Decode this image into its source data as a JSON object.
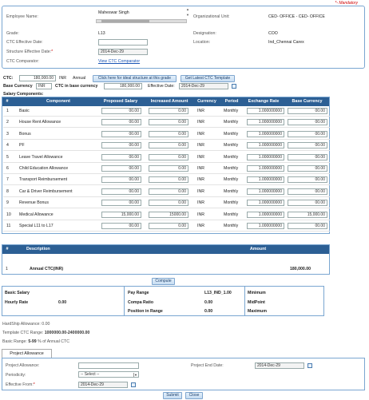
{
  "mandatory_note": "*- Mandatory",
  "employee": {
    "name_label": "Employee Name:",
    "name_value": "Maheswar Singh",
    "grade_label": "Grade:",
    "grade_value": "L13",
    "ctc_eff_label": "CTC Effective Date:",
    "ctc_eff_value": "",
    "struct_eff_label": "Structure Effective Date:",
    "struct_eff_value": "2014-Dec-29",
    "comparator_label": "CTC Comparator:",
    "comparator_link": "View CTC Comparator",
    "org_label": "Organizational Unit:",
    "org_value": "CED- OFFICE - CED- OFFICE",
    "desig_label": "Designation:",
    "desig_value": "COO",
    "location_label": "Location:",
    "location_value": "Ind_Chennai Carex"
  },
  "ctc_bar": {
    "ctc_label": "CTC:",
    "ctc_value": "180,000.00",
    "currency": "INR",
    "period": "Annual",
    "ideal_btn": "Click here for ideal structure at this grade",
    "latest_btn": "Get Latest CTC Template",
    "base_currency_label": "Base Currency",
    "base_currency_value": "INR",
    "ctc_base_label": "CTC in base currency",
    "ctc_base_value": "180,000.00",
    "eff_date_label": "Effective Date:",
    "eff_date_value": "2014-Dec-29"
  },
  "salary_components_title": "Salary Components:",
  "salary_table": {
    "headers": [
      "#",
      "Component",
      "Proposed Salary",
      "Increased Amount",
      "Currency",
      "Period",
      "Exchange Rate",
      "Base Currency"
    ],
    "rows": [
      {
        "no": "1",
        "name": "Basic",
        "proposed": "00.00",
        "increase": "0.00",
        "currency": "INR",
        "period": "Monthly",
        "rate": "1.000000000",
        "base": "00.00"
      },
      {
        "no": "2",
        "name": "House Rent Allowance",
        "proposed": "00.00",
        "increase": "0.00",
        "currency": "INR",
        "period": "Monthly",
        "rate": "1.000000000",
        "base": "00.00"
      },
      {
        "no": "3",
        "name": "Bonus",
        "proposed": "00.00",
        "increase": "0.00",
        "currency": "INR",
        "period": "Monthly",
        "rate": "1.000000000",
        "base": "00.00"
      },
      {
        "no": "4",
        "name": "PF",
        "proposed": "00.00",
        "increase": "0.00",
        "currency": "INR",
        "period": "Monthly",
        "rate": "1.000000000",
        "base": "00.00"
      },
      {
        "no": "5",
        "name": "Leave Travel Allowance",
        "proposed": "00.00",
        "increase": "0.00",
        "currency": "INR",
        "period": "Monthly",
        "rate": "1.000000000",
        "base": "00.00"
      },
      {
        "no": "6",
        "name": "Child Education Allowance",
        "proposed": "00.00",
        "increase": "0.00",
        "currency": "INR",
        "period": "Monthly",
        "rate": "1.000000000",
        "base": "00.00"
      },
      {
        "no": "7",
        "name": "Transport Reimbursement",
        "proposed": "00.00",
        "increase": "0.00",
        "currency": "INR",
        "period": "Monthly",
        "rate": "1.000000000",
        "base": "00.00"
      },
      {
        "no": "8",
        "name": "Car & Driver Reimbursement",
        "proposed": "00.00",
        "increase": "0.00",
        "currency": "INR",
        "period": "Monthly",
        "rate": "1.000000000",
        "base": "00.00"
      },
      {
        "no": "9",
        "name": "Revenue Bonus",
        "proposed": "00.00",
        "increase": "0.00",
        "currency": "INR",
        "period": "Monthly",
        "rate": "1.000000000",
        "base": "00.00"
      },
      {
        "no": "10",
        "name": "Medical Allowance",
        "proposed": "15,000.00",
        "increase": "15000.00",
        "currency": "INR",
        "period": "Monthly",
        "rate": "1.000000000",
        "base": "15,000.00"
      },
      {
        "no": "11",
        "name": "Special L11 to L17",
        "proposed": "00.00",
        "increase": "0.00",
        "currency": "INR",
        "period": "Monthly",
        "rate": "1.000000000",
        "base": "00.00"
      }
    ]
  },
  "summary_table": {
    "headers": [
      "#",
      "Description",
      "Amount"
    ],
    "row": {
      "no": "1",
      "desc": "Annual CTC(INR)",
      "amount": "180,000.00"
    }
  },
  "compute_btn": "Compute",
  "info_box": {
    "basic_salary_label": "Basic Salary",
    "hourly_rate_label": "Hourly Rate",
    "hourly_rate_value": "0.00",
    "pay_range_label": "Pay Range",
    "pay_range_value": "L13_IND_1.00",
    "compa_ratio_label": "Compa Ratio",
    "compa_ratio_value": "0.00",
    "position_label": "Position in Range",
    "position_value": "0.00",
    "minimum_label": "Minimum",
    "midpoint_label": "MidPoint",
    "maximum_label": "Maximum"
  },
  "hardship": "HardShip Allowance: 0.00",
  "template_range_label": "Template CTC Range:",
  "template_range_value": "1000000.00-2400000.00",
  "basic_range_label": "Basic Range:",
  "basic_range_value": "5-99",
  "basic_range_suffix": "% of Annual CTC",
  "project_tab": "Project Allowance",
  "project": {
    "allowance_label": "Project Allowance:",
    "allowance_value": "",
    "periodicity_label": "Periodicity:",
    "periodicity_value": "-- Select --",
    "eff_from_label": "Effective From:",
    "eff_from_value": "2014-Dec-29",
    "end_date_label": "Project End Date:",
    "end_date_value": "2014-Dec-29"
  },
  "submit_btn": "Submit",
  "close_btn": "Close",
  "colors": {
    "accent": "#2c5f94",
    "border": "#7aa6d1",
    "mandatory": "#d00000"
  }
}
